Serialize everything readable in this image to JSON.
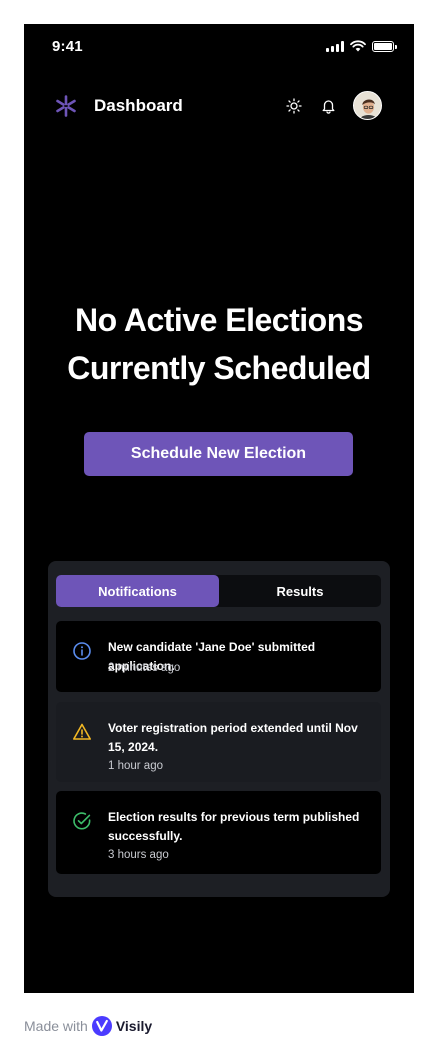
{
  "status_bar": {
    "time": "9:41"
  },
  "header": {
    "title": "Dashboard",
    "logo_icon": "sparkle-asterisk-icon",
    "actions": [
      "sun-icon",
      "bell-icon",
      "avatar"
    ]
  },
  "hero": {
    "title_line1": "No Active Elections",
    "title_line2": "Currently Scheduled",
    "button_label": "Schedule New Election"
  },
  "panel": {
    "tabs": [
      {
        "label": "Notifications",
        "active": true
      },
      {
        "label": "Results",
        "active": false
      }
    ],
    "notifications": [
      {
        "icon": "info-icon",
        "icon_color": "#5b8def",
        "text": "New candidate 'Jane Doe' submitted application.",
        "time": "2 minutes ago"
      },
      {
        "icon": "warning-icon",
        "icon_color": "#f2b824",
        "text": "Voter registration period extended until Nov 15, 2024.",
        "time": "1 hour ago"
      },
      {
        "icon": "check-circle-icon",
        "icon_color": "#3dbd6a",
        "text": "Election results for previous term published successfully.",
        "time": "3 hours ago"
      }
    ]
  },
  "footer": {
    "made_with": "Made with",
    "brand": "Visily"
  },
  "colors": {
    "accent": "#6e55b8",
    "background": "#000000",
    "panel": "#1d1f24"
  }
}
